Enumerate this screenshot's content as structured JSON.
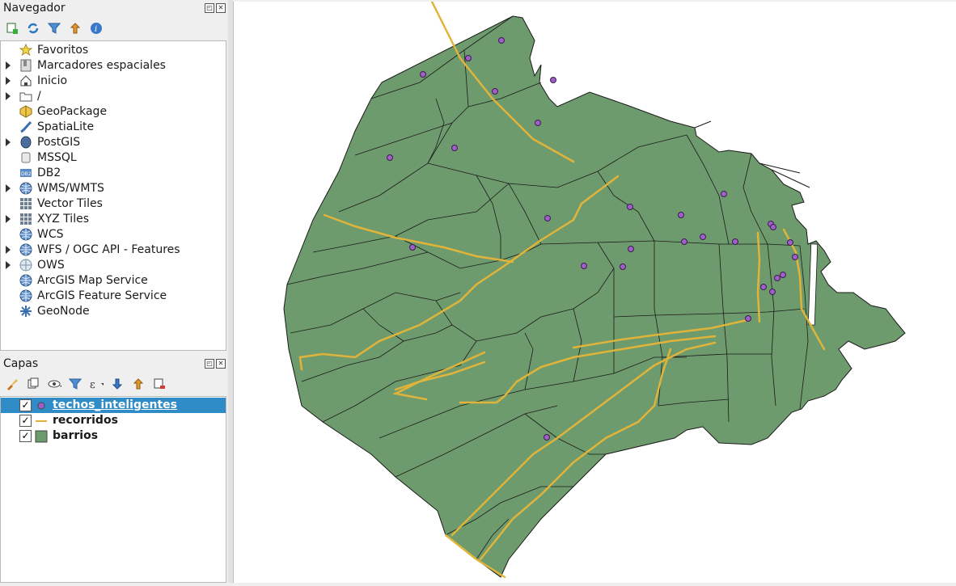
{
  "navigator": {
    "title": "Navegador",
    "items": [
      {
        "label": "Favoritos",
        "icon": "star-icon",
        "expandable": false
      },
      {
        "label": "Marcadores espaciales",
        "icon": "bookmark-icon",
        "expandable": true
      },
      {
        "label": "Inicio",
        "icon": "home-icon",
        "expandable": true
      },
      {
        "label": "/",
        "icon": "folder-icon",
        "expandable": true
      },
      {
        "label": "GeoPackage",
        "icon": "geopackage-icon",
        "expandable": false
      },
      {
        "label": "SpatiaLite",
        "icon": "spatialite-icon",
        "expandable": false
      },
      {
        "label": "PostGIS",
        "icon": "postgis-icon",
        "expandable": true
      },
      {
        "label": "MSSQL",
        "icon": "mssql-icon",
        "expandable": false
      },
      {
        "label": "DB2",
        "icon": "db2-icon",
        "expandable": false
      },
      {
        "label": "WMS/WMTS",
        "icon": "globe-icon",
        "expandable": true
      },
      {
        "label": "Vector Tiles",
        "icon": "grid-icon",
        "expandable": false
      },
      {
        "label": "XYZ Tiles",
        "icon": "grid-icon",
        "expandable": true
      },
      {
        "label": "WCS",
        "icon": "globe-icon",
        "expandable": false
      },
      {
        "label": "WFS / OGC API - Features",
        "icon": "globe-icon",
        "expandable": true
      },
      {
        "label": "OWS",
        "icon": "globe-light-icon",
        "expandable": true
      },
      {
        "label": "ArcGIS Map Service",
        "icon": "globe-icon",
        "expandable": false
      },
      {
        "label": "ArcGIS Feature Service",
        "icon": "globe-icon",
        "expandable": false
      },
      {
        "label": "GeoNode",
        "icon": "geonode-icon",
        "expandable": false
      }
    ]
  },
  "layers": {
    "title": "Capas",
    "items": [
      {
        "label": "techos_inteligentes",
        "checked": true,
        "selected": true,
        "type": "point"
      },
      {
        "label": "recorridos",
        "checked": true,
        "selected": false,
        "type": "line"
      },
      {
        "label": "barrios",
        "checked": true,
        "selected": false,
        "type": "polygon"
      }
    ]
  },
  "map": {
    "polygon_fill": "#6e9b6e",
    "line_color": "#e0b43a",
    "point_fill": "#a05fc8"
  }
}
